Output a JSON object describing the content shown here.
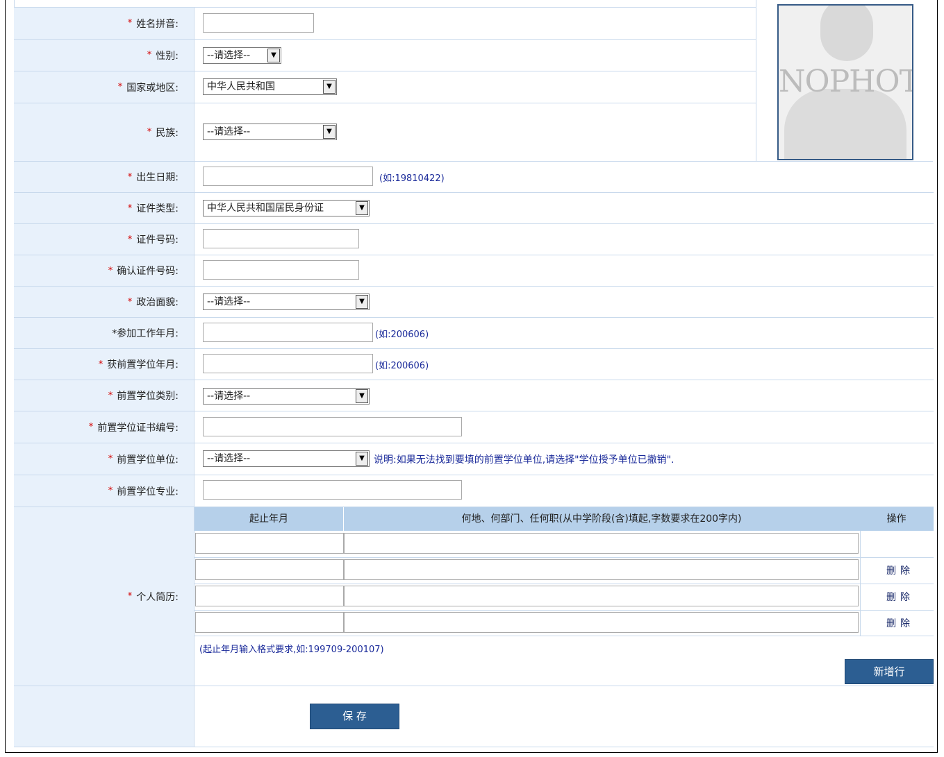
{
  "form": {
    "fields": [
      {
        "label": "姓名拼音:"
      },
      {
        "label": "性别:",
        "value": "--请选择--"
      },
      {
        "label": "国家或地区:",
        "value": "中华人民共和国"
      },
      {
        "label": "民族:",
        "value": "--请选择--"
      },
      {
        "label": "出生日期:",
        "hint": "(如:19810422)"
      },
      {
        "label": "证件类型:",
        "value": "中华人民共和国居民身份证"
      },
      {
        "label": "证件号码:"
      },
      {
        "label": "确认证件号码:"
      },
      {
        "label": "政治面貌:",
        "value": "--请选择--"
      },
      {
        "label": "*参加工作年月:",
        "hint": "(如:200606)"
      },
      {
        "label": "获前置学位年月:",
        "hint": "(如:200606)"
      },
      {
        "label": "前置学位类别:",
        "value": "--请选择--"
      },
      {
        "label": "前置学位证书编号:"
      },
      {
        "label": "前置学位单位:",
        "value": "--请选择--",
        "hint": "说明:如果无法找到要填的前置学位单位,请选择\"学位授予单位已撤销\"."
      },
      {
        "label": "前置学位专业:"
      },
      {
        "label": "个人简历:"
      }
    ],
    "star": "*"
  },
  "photo": {
    "placeholder_text": "NOPHOTO"
  },
  "resume": {
    "headers": [
      "起止年月",
      "何地、何部门、任何职(从中学阶段(含)填起,字数要求在200字内)",
      "操作"
    ],
    "delete_label": "删除",
    "format_hint": "(起止年月输入格式要求,如:199709-200107)",
    "add_row_label": "新增行"
  },
  "save_label": "保 存",
  "colors": {
    "accent": "#2c5e92",
    "label_bg": "#e8f1fb",
    "header_bg": "#b6d0ea",
    "required": "#d40000"
  }
}
